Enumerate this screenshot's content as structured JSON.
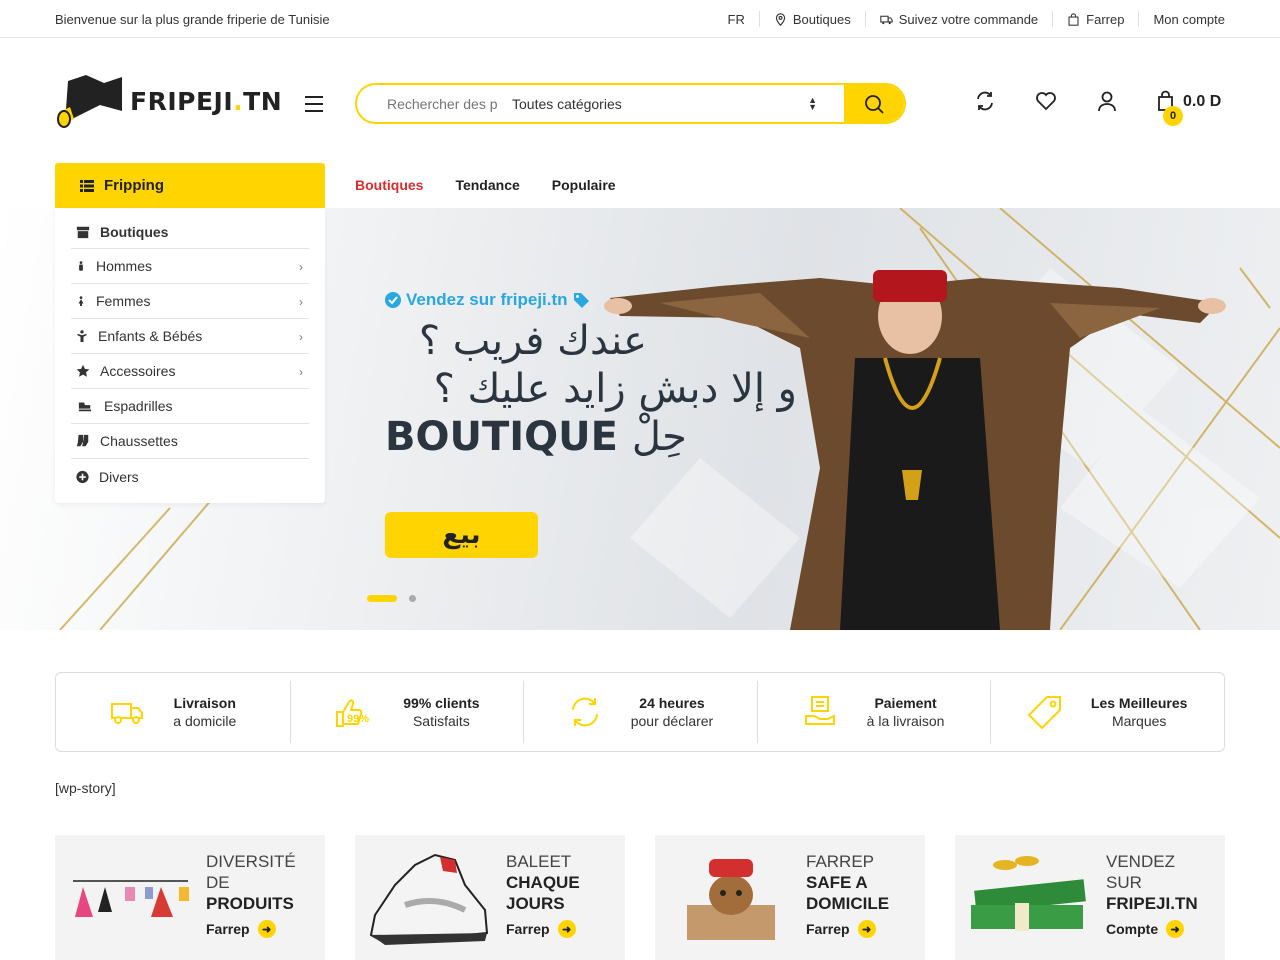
{
  "topbar": {
    "welcome": "Bienvenue sur la plus grande friperie de Tunisie",
    "lang": "FR",
    "stores": "Boutiques",
    "track": "Suivez votre commande",
    "farrep": "Farrep",
    "account": "Mon compte"
  },
  "header": {
    "brand_main": "FRIPEJI",
    "brand_dot": ".",
    "brand_tld": "TN",
    "search_placeholder": "Rechercher des produits",
    "category_selected": "Toutes catégories",
    "cart_amount": "0.0 D",
    "cart_count": "0"
  },
  "nav": {
    "category_button": "Fripping",
    "links": [
      "Boutiques",
      "Tendance",
      "Populaire"
    ]
  },
  "category_menu": [
    {
      "label": "Boutiques",
      "icon": "store-icon"
    },
    {
      "label": "Hommes",
      "icon": "male-icon"
    },
    {
      "label": "Femmes",
      "icon": "female-icon"
    },
    {
      "label": "Enfants & Bébés",
      "icon": "child-icon"
    },
    {
      "label": "Accessoires",
      "icon": "star-icon"
    },
    {
      "label": "Espadrilles",
      "icon": "shoe-icon"
    },
    {
      "label": "Chaussettes",
      "icon": "socks-icon"
    },
    {
      "label": "Divers",
      "icon": "plus-circle-icon"
    }
  ],
  "banner": {
    "tag": "Vendez sur fripeji.tn",
    "line1": "عندك فريب ؟",
    "line2": "و إلا دبش زايد عليك ؟",
    "line3_bold": "BOUTIQUE",
    "line3_ar": "حِلْ",
    "button": "بيع",
    "slides": 2,
    "active_slide": 1
  },
  "features": [
    {
      "title": "Livraison",
      "sub": "a domicile",
      "icon": "truck-icon"
    },
    {
      "title": "99% clients",
      "sub": "Satisfaits",
      "icon": "thumbs-up-icon",
      "badge": "99%"
    },
    {
      "title": "24 heures",
      "sub": "pour déclarer",
      "icon": "refresh-icon"
    },
    {
      "title": "Paiement",
      "sub": "à la livraison",
      "icon": "payment-icon"
    },
    {
      "title": "Les Meilleures",
      "sub": "Marques",
      "icon": "tag-icon"
    }
  ],
  "wp_story": "[wp-story]",
  "cards": [
    {
      "l1": "DIVERSITÉ",
      "l2": "DE",
      "l3": "PRODUITS",
      "link": "Farrep"
    },
    {
      "l1": "BALEET",
      "l2": "CHAQUE",
      "l3": "JOURS",
      "link": "Farrep"
    },
    {
      "l1": "FARREP",
      "l2": "SAFE A",
      "l3": "DOMICILE",
      "link": "Farrep"
    },
    {
      "l1": "VENDEZ",
      "l2": "SUR",
      "l3": "FRIPEJI.TN",
      "link": "Compte"
    }
  ],
  "colors": {
    "accent": "#ffd400",
    "active_link": "#d32f2f",
    "tag_blue": "#29a7e1"
  }
}
